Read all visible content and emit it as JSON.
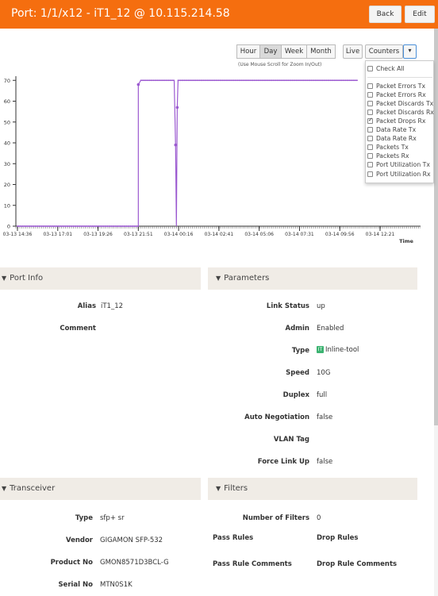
{
  "header": {
    "title": "Port: 1/1/x12 - iT1_12 @ 10.115.214.58",
    "back_label": "Back",
    "edit_label": "Edit"
  },
  "toolbar": {
    "ranges": [
      "Hour",
      "Day",
      "Week",
      "Month"
    ],
    "active_range": "Day",
    "live_label": "Live",
    "counters_label": "Counters",
    "zoom_hint": "(Use Mouse Scroll for Zoom In/Out)"
  },
  "counters_menu": {
    "check_all": "Check All",
    "items": [
      {
        "label": "Packet Errors Tx",
        "checked": false
      },
      {
        "label": "Packet Errors Rx",
        "checked": false
      },
      {
        "label": "Packet Discards Tx",
        "checked": false
      },
      {
        "label": "Packet Discards Rx",
        "checked": false
      },
      {
        "label": "Packet Drops Rx",
        "checked": true
      },
      {
        "label": "Data Rate Tx",
        "checked": false
      },
      {
        "label": "Data Rate Rx",
        "checked": false
      },
      {
        "label": "Packets Tx",
        "checked": false
      },
      {
        "label": "Packets Rx",
        "checked": false
      },
      {
        "label": "Port Utilization Tx",
        "checked": false
      },
      {
        "label": "Port Utilization Rx",
        "checked": false
      }
    ]
  },
  "chart_data": {
    "type": "line",
    "xlabel": "Time",
    "x_ticks": [
      "03-13 14:36",
      "03-13 17:01",
      "03-13 19:26",
      "03-13 21:51",
      "03-14 00:16",
      "03-14 02:41",
      "03-14 05:06",
      "03-14 07:31",
      "03-14 09:56",
      "03-14 12:21"
    ],
    "y_ticks": [
      0,
      10,
      20,
      30,
      40,
      50,
      60,
      70
    ],
    "ylim": [
      0,
      72
    ],
    "series_color": "#9b59d0",
    "series": [
      {
        "values": [
          {
            "x": "03-13 14:36",
            "y": 0
          },
          {
            "x": "03-13 21:51",
            "y": 0
          },
          {
            "x": "03-13 21:51",
            "y": 68
          },
          {
            "x": "03-13 22:00",
            "y": 70
          },
          {
            "x": "03-14 00:00",
            "y": 70
          },
          {
            "x": "03-14 00:05",
            "y": 39
          },
          {
            "x": "03-14 00:08",
            "y": 0
          },
          {
            "x": "03-14 00:11",
            "y": 57
          },
          {
            "x": "03-14 00:14",
            "y": 70
          },
          {
            "x": "03-14 11:00",
            "y": 70
          }
        ]
      }
    ]
  },
  "port_info": {
    "title": "Port Info",
    "rows": [
      {
        "label": "Alias",
        "value": "iT1_12"
      },
      {
        "label": "Comment",
        "value": ""
      }
    ]
  },
  "parameters": {
    "title": "Parameters",
    "rows": [
      {
        "label": "Link Status",
        "value": "up"
      },
      {
        "label": "Admin",
        "value": "Enabled"
      },
      {
        "label": "Type",
        "value": "Inline-tool",
        "badge": "IT"
      },
      {
        "label": "Speed",
        "value": "10G"
      },
      {
        "label": "Duplex",
        "value": "full"
      },
      {
        "label": "Auto Negotiation",
        "value": "false"
      },
      {
        "label": "VLAN Tag",
        "value": ""
      },
      {
        "label": "Force Link Up",
        "value": "false"
      }
    ]
  },
  "transceiver": {
    "title": "Transceiver",
    "rows": [
      {
        "label": "Type",
        "value": "sfp+ sr"
      },
      {
        "label": "Vendor",
        "value": "GIGAMON SFP-532"
      },
      {
        "label": "Product No",
        "value": "GMON8571D3BCL-G"
      },
      {
        "label": "Serial No",
        "value": "MTN0S1K"
      }
    ]
  },
  "filters": {
    "title": "Filters",
    "number_label": "Number of Filters",
    "number_value": "0",
    "pass_rules": "Pass Rules",
    "drop_rules": "Drop Rules",
    "pass_rule_comments": "Pass Rule Comments",
    "drop_rule_comments": "Drop Rule Comments"
  }
}
